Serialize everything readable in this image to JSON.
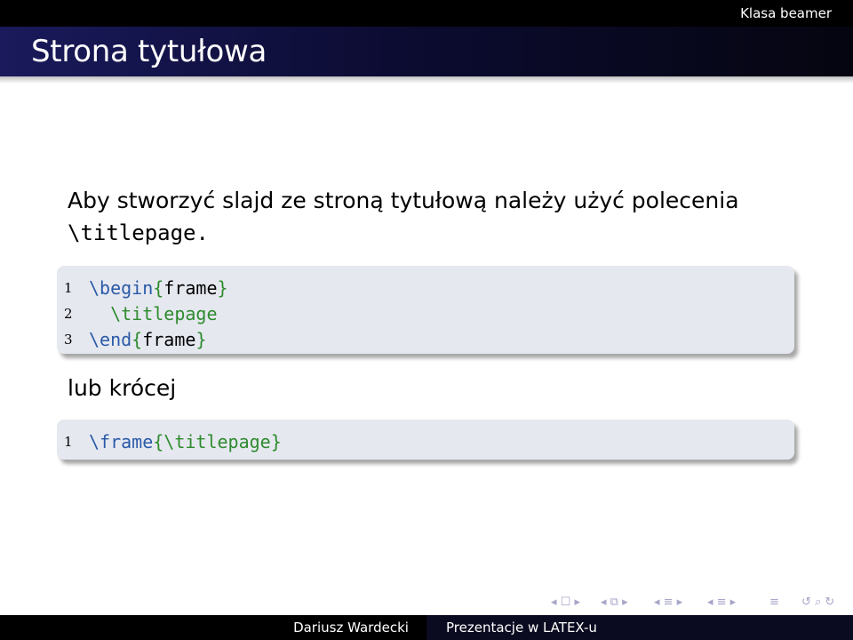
{
  "header": {
    "section": "Klasa beamer"
  },
  "frame": {
    "title": "Strona tytułowa"
  },
  "body": {
    "intro_text": "Aby stworzyć slajd ze stroną tytułową należy użyć polecenia",
    "intro_command": "\\titlepage.",
    "code1": [
      {
        "num": "1",
        "parts": [
          {
            "t": "\\begin",
            "c": "kw"
          },
          {
            "t": "{",
            "c": "br"
          },
          {
            "t": "frame",
            "c": "plain"
          },
          {
            "t": "}",
            "c": "br"
          }
        ]
      },
      {
        "num": "2",
        "parts": [
          {
            "t": "  \\titlepage",
            "c": "br"
          }
        ]
      },
      {
        "num": "3",
        "parts": [
          {
            "t": "\\end",
            "c": "kw"
          },
          {
            "t": "{",
            "c": "br"
          },
          {
            "t": "frame",
            "c": "plain"
          },
          {
            "t": "}",
            "c": "br"
          }
        ]
      }
    ],
    "middle_text": "lub krócej",
    "code2": [
      {
        "num": "1",
        "parts": [
          {
            "t": "\\frame",
            "c": "kw"
          },
          {
            "t": "{",
            "c": "br"
          },
          {
            "t": "\\titlepage",
            "c": "br"
          },
          {
            "t": "}",
            "c": "br"
          }
        ]
      }
    ]
  },
  "footer": {
    "author": "Dariusz Wardecki",
    "presentation_title": "Prezentacje w LATEX-u"
  },
  "colors": {
    "command_blue": "#2a5aa8",
    "brace_green": "#2e8b2e",
    "code_bg": "#e6e8f0",
    "nav_symbols": "#a6a6c8"
  }
}
